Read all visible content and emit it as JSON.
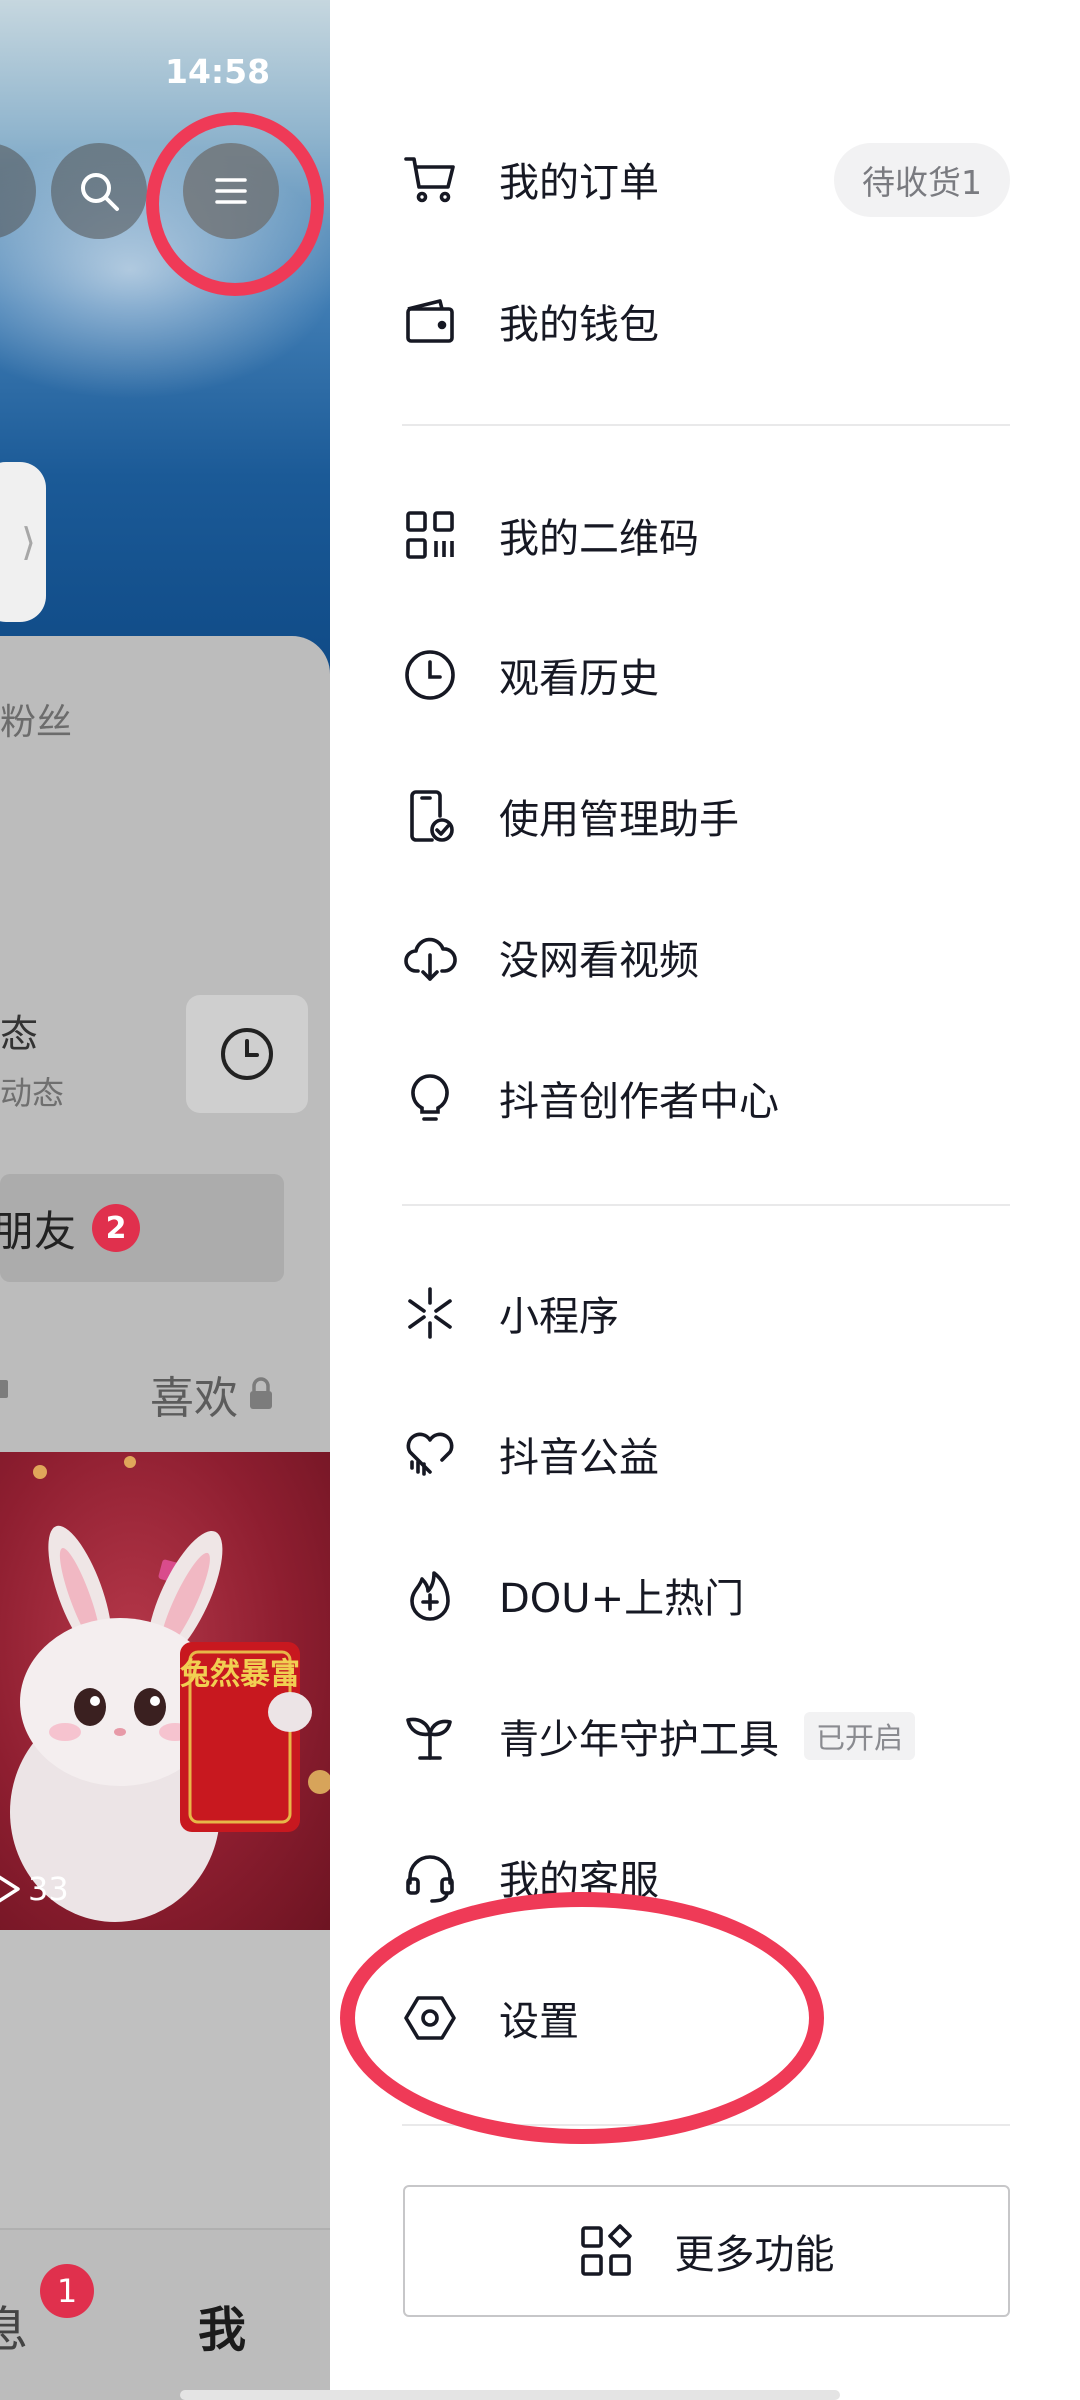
{
  "status_bar": {
    "time": "14:58"
  },
  "profile_background": {
    "fans_label": "粉丝",
    "dynamics_title": "态",
    "dynamics_subtitle": "动态",
    "friends_label": "朋友",
    "friends_badge": "2",
    "likes_tab": "喜欢",
    "video_views": "33",
    "poster_text": "兔然暴富",
    "bottom_nav": {
      "messages_label": "息",
      "messages_badge": "1",
      "me_label": "我"
    }
  },
  "drawer": {
    "items": [
      {
        "label": "我的订单",
        "icon": "cart-icon"
      },
      {
        "label": "我的钱包",
        "icon": "wallet-icon"
      },
      {
        "label": "我的二维码",
        "icon": "qrcode-icon"
      },
      {
        "label": "观看历史",
        "icon": "clock-icon"
      },
      {
        "label": "使用管理助手",
        "icon": "phone-check-icon"
      },
      {
        "label": "没网看视频",
        "icon": "cloud-download-icon"
      },
      {
        "label": "抖音创作者中心",
        "icon": "lightbulb-icon"
      },
      {
        "label": "小程序",
        "icon": "spark-icon"
      },
      {
        "label": "抖音公益",
        "icon": "heart-hand-icon"
      },
      {
        "label": "DOU+上热门",
        "icon": "flame-plus-icon"
      },
      {
        "label": "青少年守护工具",
        "icon": "sprout-icon"
      },
      {
        "label": "我的客服",
        "icon": "headset-icon"
      },
      {
        "label": "设置",
        "icon": "hexagon-settings-icon"
      }
    ],
    "order_status": "待收货1",
    "youth_status": "已开启",
    "more_button": "更多功能"
  },
  "annotations": {
    "color": "#ef3a57",
    "highlighted": [
      "menu-button",
      "settings-menu-item"
    ]
  }
}
